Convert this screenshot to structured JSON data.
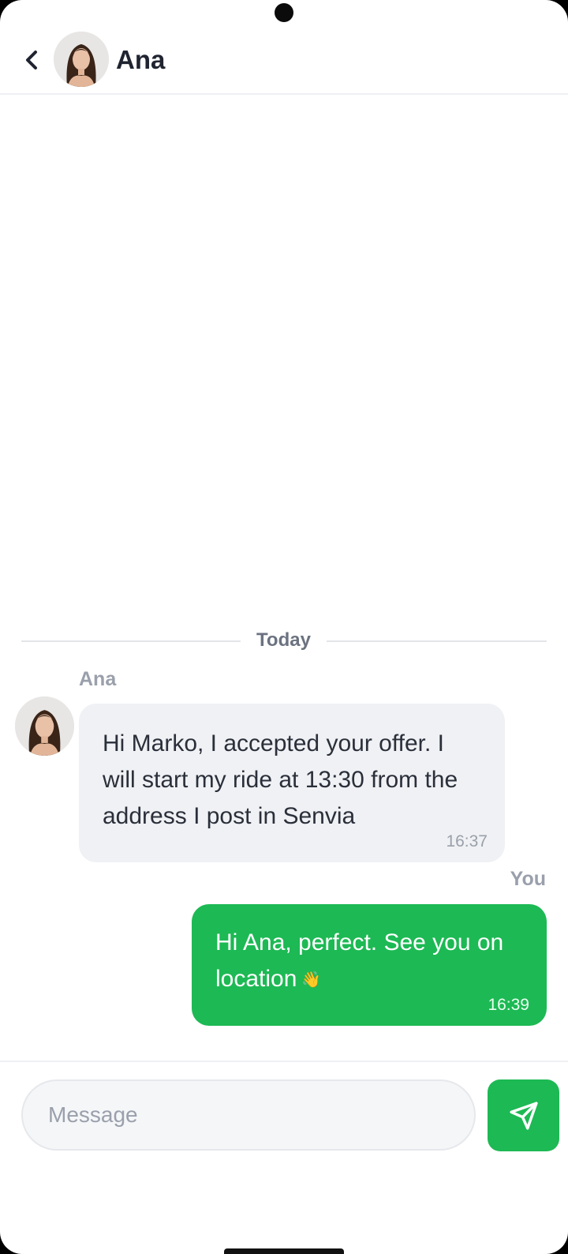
{
  "header": {
    "contact_name": "Ana",
    "avatar_icon": "person-photo-icon",
    "back_icon": "chevron-left-icon"
  },
  "chat": {
    "day_separator": "Today",
    "messages": [
      {
        "sender": "Ana",
        "direction": "incoming",
        "text": "Hi Marko, I accepted your offer. I will start my ride at 13:30 from the address I post in Senvia",
        "time": "16:37"
      },
      {
        "sender": "You",
        "direction": "outgoing",
        "text": "Hi Ana, perfect. See you on location",
        "emoji": "👋",
        "time": "16:39"
      }
    ]
  },
  "composer": {
    "placeholder": "Message",
    "value": "",
    "send_icon": "send-icon"
  },
  "colors": {
    "accent": "#1db954",
    "incoming_bubble": "#f0f1f4",
    "text_dark": "#1f2430",
    "muted": "#9aa0ab"
  }
}
